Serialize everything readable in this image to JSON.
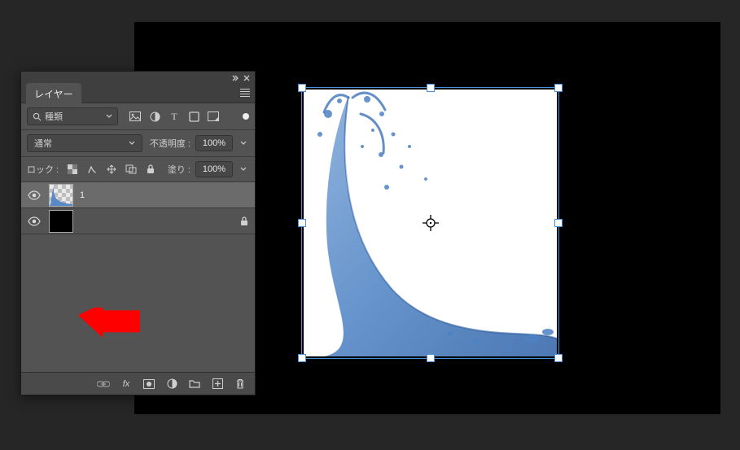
{
  "panel": {
    "title": "レイヤー",
    "filter": {
      "search_label": "種類",
      "icons": [
        "image-icon",
        "adjustment-icon",
        "type-icon",
        "shape-icon",
        "smartobject-icon"
      ]
    },
    "blend": {
      "mode": "通常",
      "opacity_label": "不透明度 :",
      "opacity_value": "100%"
    },
    "lock": {
      "label": "ロック :",
      "icons": [
        "lock-pixels-icon",
        "lock-brush-icon",
        "lock-position-icon",
        "lock-artboard-icon",
        "lock-all-icon"
      ],
      "fill_label": "塗り :",
      "fill_value": "100%"
    },
    "layers": [
      {
        "name": "1",
        "visible": true,
        "selected": true,
        "thumb": "checker",
        "locked": false
      },
      {
        "name": "",
        "visible": true,
        "selected": false,
        "thumb": "black",
        "locked": true
      }
    ],
    "footer_icons": [
      "link-icon",
      "fx-icon",
      "mask-icon",
      "adjustment-layer-icon",
      "group-icon",
      "new-layer-icon",
      "trash-icon"
    ]
  },
  "canvas": {
    "transform_handles": 8
  }
}
